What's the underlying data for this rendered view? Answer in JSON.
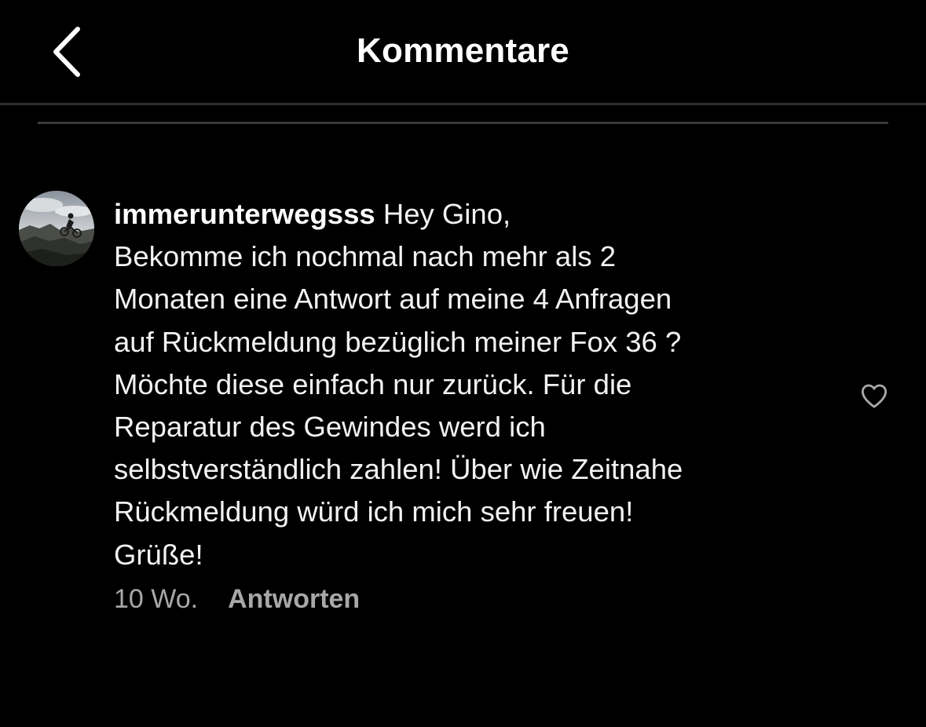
{
  "header": {
    "title": "Kommentare",
    "back_icon": "chevron-left-icon"
  },
  "comment": {
    "username": "immerunterwegsss",
    "first_line_text": " Hey Gino,",
    "lines": [
      "Bekomme ich nochmal nach mehr als 2",
      "Monaten eine Antwort auf meine 4 Anfragen",
      "auf Rückmeldung bezüglich meiner Fox 36 ?",
      "Möchte diese einfach nur zurück. Für die",
      "Reparatur des Gewindes werd ich",
      "selbstverständlich zahlen! Über wie Zeitnahe",
      "Rückmeldung würd ich mich sehr freuen!",
      "Grüße!"
    ],
    "time": "10 Wo.",
    "reply_label": "Antworten",
    "like_icon": "heart-outline-icon"
  }
}
